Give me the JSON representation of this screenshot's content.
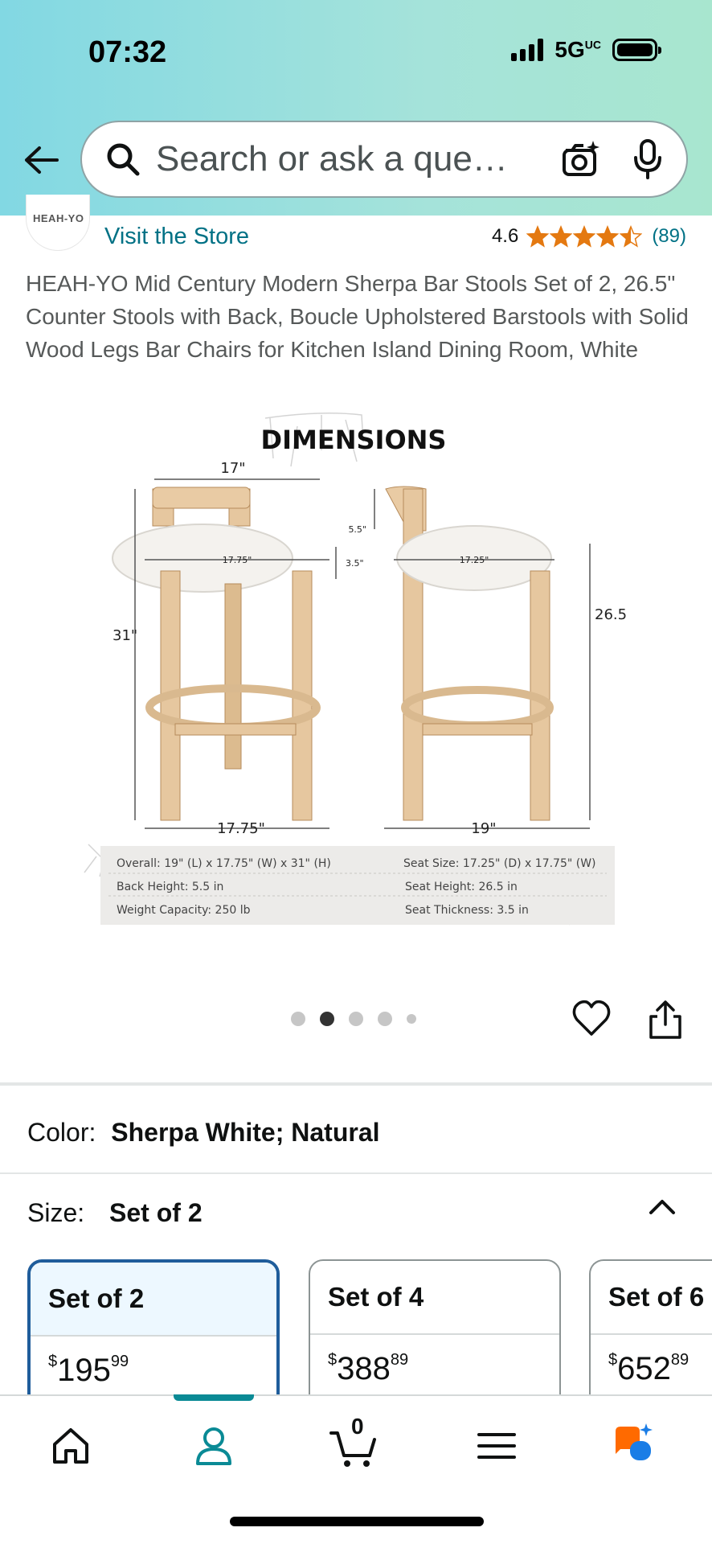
{
  "status": {
    "time": "07:32",
    "network": "5GUC"
  },
  "search": {
    "placeholder": "Search or ask a que…"
  },
  "store": {
    "logo_text": "HEAH-YO",
    "visit_label": "Visit the Store",
    "rating": "4.6",
    "review_count": "(89)",
    "stars": 4.5
  },
  "product": {
    "title": "HEAH-YO Mid Century Modern Sherpa Bar Stools Set of 2, 26.5\" Counter Stools with Back, Boucle Upholstered Barstools with Solid Wood Legs Bar Chairs for Kitchen Island Dining Room, White"
  },
  "image": {
    "heading": "DIMENSIONS",
    "front_top_width": "17\"",
    "front_seat_width": "17.75\"",
    "seat_thickness_label": "3.5\"",
    "front_height": "31\"",
    "front_base_width": "17.75\"",
    "side_back_height": "5.5\"",
    "side_seat_depth": "17.25\"",
    "side_seat_height": "26.5\"",
    "side_base_width": "19\"",
    "specs_left": [
      "Overall: 19\" (L) x 17.75\" (W) x 31\" (H)",
      "Back Height: 5.5 in",
      "Weight Capacity: 250 lb"
    ],
    "specs_right": [
      "Seat Size: 17.25\" (D) x 17.75\" (W)",
      "Seat Height: 26.5 in",
      "Seat Thickness: 3.5 in"
    ]
  },
  "carousel": {
    "total": 5,
    "active": 2
  },
  "options": {
    "color_label": "Color:",
    "color_value": "Sherpa White; Natural",
    "size_label": "Size:",
    "size_value": "Set of 2"
  },
  "sizes": [
    {
      "label": "Set of 2",
      "dollars": "195",
      "cents": "99",
      "currency": "$",
      "selected": true
    },
    {
      "label": "Set of 4",
      "dollars": "388",
      "cents": "89",
      "currency": "$",
      "selected": false
    },
    {
      "label": "Set of 6",
      "dollars": "652",
      "cents": "89",
      "currency": "$",
      "selected": false
    }
  ],
  "tabs": {
    "cart_count": "0",
    "active": "profile"
  },
  "colors": {
    "link": "#007185",
    "star": "#e47911",
    "selected_border": "#1f5d9b",
    "tab_accent": "#0a8a95"
  }
}
